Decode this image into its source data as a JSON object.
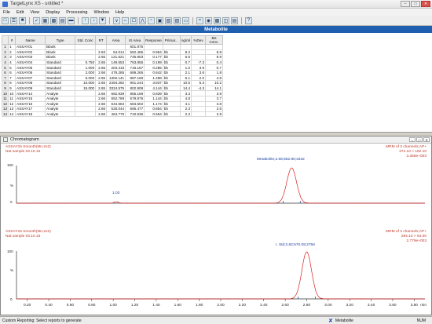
{
  "window": {
    "title": "TargetLynx XS - untitled *"
  },
  "menu": [
    "File",
    "Edit",
    "View",
    "Display",
    "Processing",
    "Window",
    "Help"
  ],
  "table": {
    "title": "Metabolite",
    "columns": [
      "",
      "#",
      "Name",
      "Type",
      "Std. Conc",
      "RT",
      "Area",
      "IS Area",
      "Response",
      "Primar...",
      "ng/ml",
      "%Dev",
      "BS Conc."
    ],
    "rows": [
      [
        "1",
        "1",
        "ASSAY01",
        "Blank",
        "",
        "",
        "",
        "601.975",
        "",
        "",
        "",
        "",
        ""
      ],
      [
        "2",
        "2",
        "ASSAY02",
        "Blank",
        "",
        "2.63",
        "54.014",
        "552.465",
        "0.954",
        "bb",
        "8.2",
        "",
        "8.9"
      ],
      [
        "3",
        "3",
        "ASSAY03",
        "Blank",
        "",
        "2.65",
        "121.621",
        "745.903",
        "0.177",
        "bb",
        "6.6",
        "",
        "8.9"
      ],
      [
        "4",
        "4",
        "ASSAY04",
        "Standard",
        "0.750",
        "2.65",
        "149.653",
        "753.855",
        "0.199",
        "bb",
        "0.7",
        "-7.3",
        "0.4"
      ],
      [
        "5",
        "5",
        "ASSAY05",
        "Standard",
        "1.000",
        "2.65",
        "204.415",
        "716.157",
        "0.285",
        "bb",
        "1.0",
        "3.9",
        "0.7"
      ],
      [
        "6",
        "6",
        "ASSAY06",
        "Standard",
        "2.000",
        "2.66",
        "479.285",
        "689.265",
        "0.642",
        "bb",
        "2.1",
        "3.6",
        "1.8"
      ],
      [
        "7",
        "7",
        "ASSAY07",
        "Standard",
        "5.000",
        "2.65",
        "1302.141",
        "887.169",
        "1.488",
        "bb",
        "5.1",
        "2.0",
        "4.8"
      ],
      [
        "8",
        "8",
        "ASSAY08",
        "Standard",
        "10.000",
        "2.65",
        "2494.282",
        "901.244",
        "3.837",
        "bb",
        "10.5",
        "5.3",
        "10.2"
      ],
      [
        "9",
        "9",
        "ASSAY09",
        "Standard",
        "15.000",
        "2.65",
        "3324.575",
        "802.909",
        "4.144",
        "bb",
        "14.4",
        "-4.3",
        "14.1"
      ],
      [
        "10",
        "10",
        "ASSAY14",
        "Analyte",
        "",
        "2.66",
        "662.939",
        "855.169",
        "0.839",
        "bb",
        "3.3",
        "",
        "3.9"
      ],
      [
        "11",
        "11",
        "ASSAY15",
        "Analyte",
        "",
        "2.66",
        "652.789",
        "579.876",
        "1.144",
        "bb",
        "4.8",
        "",
        "3.7"
      ],
      [
        "12",
        "12",
        "ASSAY16",
        "Analyte",
        "",
        "2.66",
        "644.684",
        "584.502",
        "1.174",
        "bb",
        "4.1",
        "",
        "3.8"
      ],
      [
        "13",
        "13",
        "ASSAY17",
        "Analyte",
        "",
        "2.66",
        "528.044",
        "665.477",
        "0.854",
        "bb",
        "2.3",
        "",
        "2.5"
      ],
      [
        "14",
        "14",
        "ASSAY18",
        "Analyte",
        "",
        "2.66",
        "464.775",
        "710.636",
        "0.654",
        "bb",
        "2.3",
        "",
        "2.9"
      ]
    ]
  },
  "chromatogram": {
    "title": "Chromatogram",
    "trace1": {
      "name": "ASSAY15 Smooth(Mn,2x2)",
      "sub": "Nat sample 03.10.15",
      "channel": "MRM of 3 channels,AP+",
      "transition": "274.10 > 182.10",
      "intensity": "3.358e+003",
      "peak_label": "Metabolite;2.66;652.80;3332",
      "minor_label": "1.03"
    },
    "trace2": {
      "name": "ASSAY15 Smooth(Mn,2x2)",
      "sub": "Nat sample 03.10.15",
      "channel": "MRM of 3 channels,AP+",
      "transition": "294.10 > 64.00",
      "intensity": "2.779e+003",
      "peak_label": "I. Std;2.82;570.08;2756"
    },
    "y_labels": [
      "100",
      "%",
      "0"
    ],
    "x_ticks": [
      "0.20",
      "0.40",
      "0.60",
      "0.80",
      "1.00",
      "1.20",
      "1.40",
      "1.60",
      "1.80",
      "2.00",
      "2.20",
      "2.40",
      "2.60",
      "2.80",
      "3.00",
      "3.20",
      "3.40",
      "3.60",
      "3.80"
    ],
    "x_unit": "min"
  },
  "status": {
    "left": "Custom Reporting: Select reports to generate",
    "mode": "Metabolite",
    "num": "NUM"
  }
}
